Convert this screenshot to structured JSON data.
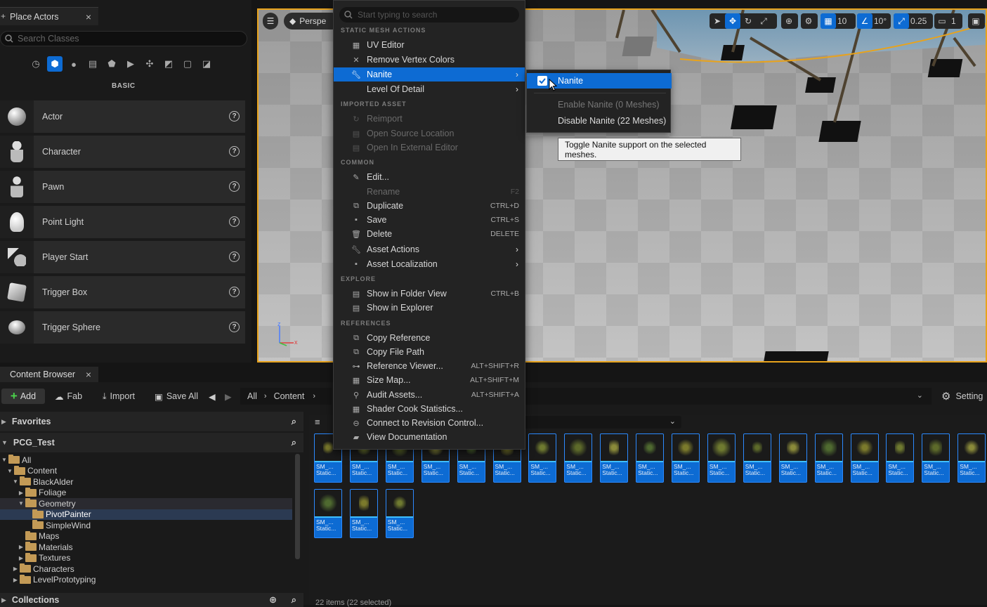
{
  "place_actors": {
    "tab_label": "Place Actors",
    "search_placeholder": "Search Classes",
    "category_label": "BASIC",
    "items": [
      {
        "label": "Actor"
      },
      {
        "label": "Character"
      },
      {
        "label": "Pawn"
      },
      {
        "label": "Point Light"
      },
      {
        "label": "Player Start"
      },
      {
        "label": "Trigger Box"
      },
      {
        "label": "Trigger Sphere"
      }
    ]
  },
  "viewport": {
    "perspective_label": "Perspe",
    "grid_snap": "10",
    "rotation_snap": "10°",
    "scale_snap": "0.25",
    "camera_speed": "1",
    "accent_color": "#e8a31c"
  },
  "context_menu": {
    "search_placeholder": "Start typing to search",
    "sections": {
      "static_mesh": "STATIC MESH ACTIONS",
      "imported": "IMPORTED ASSET",
      "common": "COMMON",
      "explore": "EXPLORE",
      "references": "REFERENCES"
    },
    "items": {
      "uv_editor": "UV Editor",
      "remove_vertex_colors": "Remove Vertex Colors",
      "nanite": "Nanite",
      "lod": "Level Of Detail",
      "reimport": "Reimport",
      "open_source": "Open Source Location",
      "open_external": "Open In External Editor",
      "edit": "Edit...",
      "rename": "Rename",
      "rename_sc": "F2",
      "duplicate": "Duplicate",
      "duplicate_sc": "CTRL+D",
      "save": "Save",
      "save_sc": "CTRL+S",
      "delete": "Delete",
      "delete_sc": "DELETE",
      "asset_actions": "Asset Actions",
      "asset_localization": "Asset Localization",
      "show_folder": "Show in Folder View",
      "show_folder_sc": "CTRL+B",
      "show_explorer": "Show in Explorer",
      "copy_ref": "Copy Reference",
      "copy_path": "Copy File Path",
      "ref_viewer": "Reference Viewer...",
      "ref_viewer_sc": "ALT+SHIFT+R",
      "size_map": "Size Map...",
      "size_map_sc": "ALT+SHIFT+M",
      "audit": "Audit Assets...",
      "audit_sc": "ALT+SHIFT+A",
      "shader_cook": "Shader Cook Statistics...",
      "revision": "Connect to Revision Control...",
      "docs": "View Documentation"
    },
    "highlight_color": "#0d6bd3"
  },
  "submenu": {
    "nanite_toggle": "Nanite",
    "enable": "Enable Nanite (0 Meshes)",
    "disable": "Disable Nanite (22 Meshes)",
    "tooltip": "Toggle Nanite support on the selected meshes."
  },
  "content_browser": {
    "tab_label": "Content Browser",
    "add_label": "Add",
    "fab_label": "Fab",
    "import_label": "Import",
    "save_all_label": "Save All",
    "path": [
      "All",
      "Content"
    ],
    "settings_label": "Setting",
    "favorites_label": "Favorites",
    "project_label": "PCG_Test",
    "collections_label": "Collections",
    "status_text": "22 items (22 selected)",
    "tree": [
      {
        "label": "All"
      },
      {
        "label": "Content"
      },
      {
        "label": "BlackAlder"
      },
      {
        "label": "Foliage"
      },
      {
        "label": "Geometry"
      },
      {
        "label": "PivotPainter"
      },
      {
        "label": "SimpleWind"
      },
      {
        "label": "Maps"
      },
      {
        "label": "Materials"
      },
      {
        "label": "Textures"
      },
      {
        "label": "Characters"
      },
      {
        "label": "LevelPrototyping"
      }
    ],
    "asset_label_line1": "SM_...",
    "asset_label_line2": "Static..."
  }
}
